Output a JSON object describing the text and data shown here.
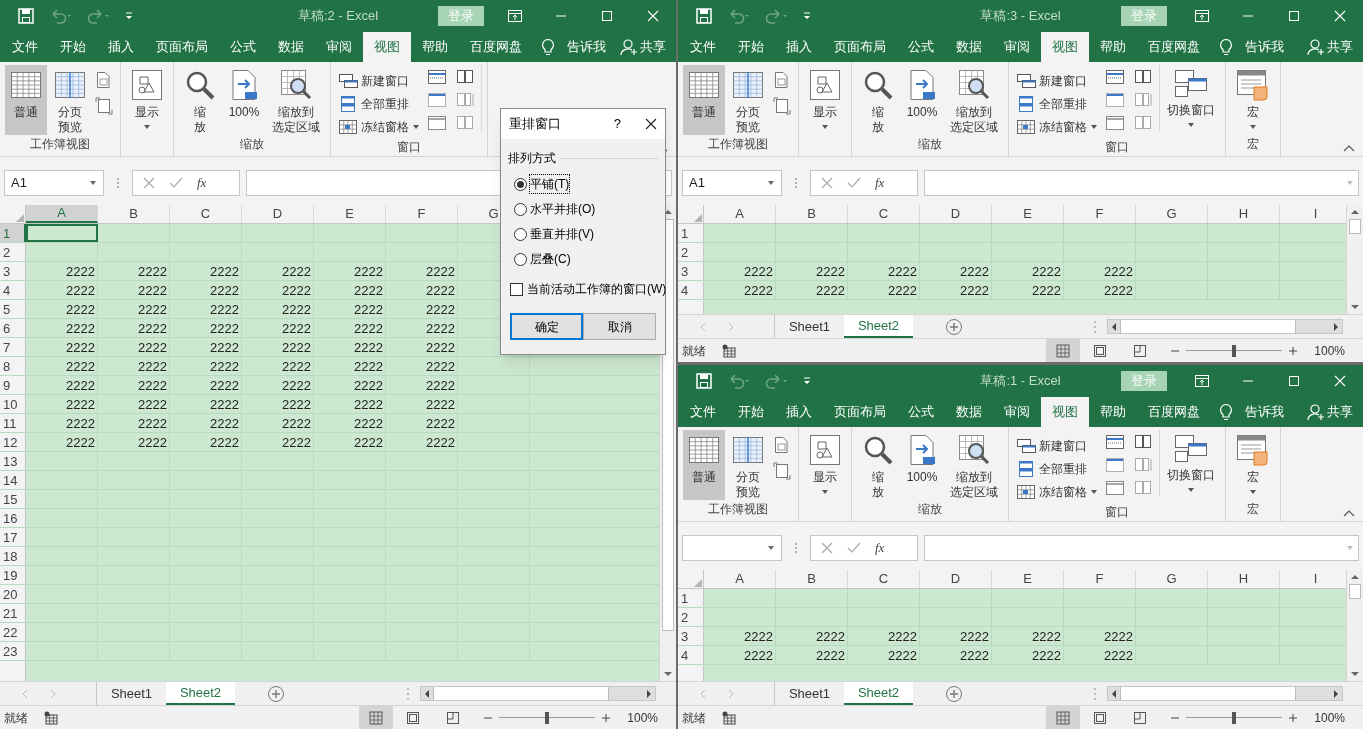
{
  "windows": [
    {
      "title": "草稿:2 - Excel",
      "login": "登录",
      "tabs": [
        {
          "label": "文件",
          "selected": false
        },
        {
          "label": "开始",
          "selected": false
        },
        {
          "label": "插入",
          "selected": false
        },
        {
          "label": "页面布局",
          "selected": false
        },
        {
          "label": "公式",
          "selected": false
        },
        {
          "label": "数据",
          "selected": false
        },
        {
          "label": "审阅",
          "selected": false
        },
        {
          "label": "视图",
          "selected": true
        },
        {
          "label": "帮助",
          "selected": false
        },
        {
          "label": "百度网盘",
          "selected": false
        }
      ],
      "tell": "告诉我",
      "share": "共享",
      "ribbon": [
        {
          "kind": "views",
          "label": "工作簿视图",
          "items": [
            {
              "label": "普通",
              "kind": "big",
              "selected": true
            },
            {
              "lines": [
                "分页",
                "预览"
              ],
              "kind": "big",
              "selected": false
            }
          ]
        },
        {
          "kind": "display",
          "items": [
            {
              "label": "显示",
              "kind": "big_dropdown"
            }
          ]
        },
        {
          "kind": "zoom",
          "label": "缩放",
          "items": [
            {
              "lines": [
                "缩",
                "放"
              ],
              "kind": "big"
            },
            {
              "label": "100%",
              "kind": "big"
            },
            {
              "lines": [
                "缩放到",
                "选定区域"
              ],
              "kind": "big"
            }
          ]
        },
        {
          "kind": "window",
          "label": "窗口",
          "items": [
            {
              "label": "新建窗口",
              "kind": "small"
            },
            {
              "label": "全部重排",
              "kind": "small"
            },
            {
              "label": "冻结窗格",
              "kind": "small_dropdown"
            }
          ]
        }
      ],
      "name_box": "A1",
      "insert_function": "fx",
      "columns": [
        {
          "label": "A",
          "selected": true
        },
        {
          "label": "B",
          "selected": false
        },
        {
          "label": "C",
          "selected": false
        },
        {
          "label": "D",
          "selected": false
        },
        {
          "label": "E",
          "selected": false
        },
        {
          "label": "F",
          "selected": false
        },
        {
          "label": "G",
          "selected": false
        }
      ],
      "rows": [
        {
          "header": "1",
          "selected": true
        },
        {
          "header": "2",
          "selected": false
        },
        {
          "header": "3",
          "selected": false,
          "cells": [
            "2222",
            "2222",
            "2222",
            "2222",
            "2222",
            "2222"
          ]
        },
        {
          "header": "4",
          "selected": false,
          "cells": [
            "2222",
            "2222",
            "2222",
            "2222",
            "2222",
            "2222"
          ]
        },
        {
          "header": "5",
          "selected": false,
          "cells": [
            "2222",
            "2222",
            "2222",
            "2222",
            "2222",
            "2222"
          ]
        },
        {
          "header": "6",
          "selected": false,
          "cells": [
            "2222",
            "2222",
            "2222",
            "2222",
            "2222",
            "2222"
          ]
        },
        {
          "header": "7",
          "selected": false,
          "cells": [
            "2222",
            "2222",
            "2222",
            "2222",
            "2222",
            "2222"
          ]
        },
        {
          "header": "8",
          "selected": false,
          "cells": [
            "2222",
            "2222",
            "2222",
            "2222",
            "2222",
            "2222"
          ]
        },
        {
          "header": "9",
          "selected": false,
          "cells": [
            "2222",
            "2222",
            "2222",
            "2222",
            "2222",
            "2222"
          ]
        },
        {
          "header": "10",
          "selected": false,
          "cells": [
            "2222",
            "2222",
            "2222",
            "2222",
            "2222",
            "2222"
          ]
        },
        {
          "header": "11",
          "selected": false,
          "cells": [
            "2222",
            "2222",
            "2222",
            "2222",
            "2222",
            "2222"
          ]
        },
        {
          "header": "12",
          "selected": false,
          "cells": [
            "2222",
            "2222",
            "2222",
            "2222",
            "2222",
            "2222"
          ]
        },
        {
          "header": "13",
          "selected": false
        },
        {
          "header": "14",
          "selected": false
        },
        {
          "header": "15",
          "selected": false
        },
        {
          "header": "16",
          "selected": false
        },
        {
          "header": "17",
          "selected": false
        },
        {
          "header": "18",
          "selected": false
        },
        {
          "header": "19",
          "selected": false
        },
        {
          "header": "20",
          "selected": false
        },
        {
          "header": "21",
          "selected": false
        },
        {
          "header": "22",
          "selected": false
        },
        {
          "header": "23",
          "selected": false
        }
      ],
      "sheets": [
        {
          "label": "Sheet1",
          "selected": false
        },
        {
          "label": "Sheet2",
          "selected": true
        }
      ],
      "status": "就绪",
      "zoom": "100%",
      "zoom_slider": {
        "level": 0.5
      }
    },
    {
      "title": "草稿:3 - Excel",
      "login": "登录",
      "tabs": [
        {
          "label": "文件",
          "selected": false
        },
        {
          "label": "开始",
          "selected": false
        },
        {
          "label": "插入",
          "selected": false
        },
        {
          "label": "页面布局",
          "selected": false
        },
        {
          "label": "公式",
          "selected": false
        },
        {
          "label": "数据",
          "selected": false
        },
        {
          "label": "审阅",
          "selected": false
        },
        {
          "label": "视图",
          "selected": true
        },
        {
          "label": "帮助",
          "selected": false
        },
        {
          "label": "百度网盘",
          "selected": false
        }
      ],
      "tell": "告诉我",
      "share": "共享",
      "ribbon": [
        {
          "kind": "views",
          "label": "工作簿视图",
          "items": [
            {
              "label": "普通",
              "kind": "big",
              "selected": true
            },
            {
              "lines": [
                "分页",
                "预览"
              ],
              "kind": "big",
              "selected": false
            }
          ]
        },
        {
          "kind": "display",
          "items": [
            {
              "label": "显示",
              "kind": "big_dropdown"
            }
          ]
        },
        {
          "kind": "zoom",
          "label": "缩放",
          "items": [
            {
              "lines": [
                "缩",
                "放"
              ],
              "kind": "big"
            },
            {
              "label": "100%",
              "kind": "big"
            },
            {
              "lines": [
                "缩放到",
                "选定区域"
              ],
              "kind": "big"
            }
          ]
        },
        {
          "kind": "window",
          "label": "窗口",
          "items": [
            {
              "label": "新建窗口",
              "kind": "small"
            },
            {
              "label": "全部重排",
              "kind": "small"
            },
            {
              "label": "冻结窗格",
              "kind": "small_dropdown"
            },
            {
              "label": "切换窗口",
              "kind": "big_dropdown"
            }
          ]
        },
        {
          "kind": "macro",
          "label": "宏",
          "items": [
            {
              "label": "宏",
              "kind": "big_dropdown"
            }
          ]
        }
      ],
      "name_box": "A1",
      "insert_function": "fx",
      "columns": [
        {
          "label": "A",
          "selected": false
        },
        {
          "label": "B",
          "selected": false
        },
        {
          "label": "C",
          "selected": false
        },
        {
          "label": "D",
          "selected": false
        },
        {
          "label": "E",
          "selected": false
        },
        {
          "label": "F",
          "selected": false
        },
        {
          "label": "G",
          "selected": false
        },
        {
          "label": "H",
          "selected": false
        },
        {
          "label": "I",
          "selected": false
        }
      ],
      "rows": [
        {
          "header": "1",
          "selected": false
        },
        {
          "header": "2",
          "selected": false
        },
        {
          "header": "3",
          "selected": false,
          "cells": [
            "2222",
            "2222",
            "2222",
            "2222",
            "2222",
            "2222"
          ]
        },
        {
          "header": "4",
          "selected": false,
          "cells": [
            "2222",
            "2222",
            "2222",
            "2222",
            "2222",
            "2222"
          ]
        }
      ],
      "sheets": [
        {
          "label": "Sheet1",
          "selected": false
        },
        {
          "label": "Sheet2",
          "selected": true
        }
      ],
      "status": "就绪",
      "zoom": "100%",
      "zoom_slider": {
        "level": 0.5
      }
    },
    {
      "title": "草稿:1 - Excel",
      "login": "登录",
      "tabs": [
        {
          "label": "文件",
          "selected": false
        },
        {
          "label": "开始",
          "selected": false
        },
        {
          "label": "插入",
          "selected": false
        },
        {
          "label": "页面布局",
          "selected": false
        },
        {
          "label": "公式",
          "selected": false
        },
        {
          "label": "数据",
          "selected": false
        },
        {
          "label": "审阅",
          "selected": false
        },
        {
          "label": "视图",
          "selected": true
        },
        {
          "label": "帮助",
          "selected": false
        },
        {
          "label": "百度网盘",
          "selected": false
        }
      ],
      "tell": "告诉我",
      "share": "共享",
      "ribbon": [
        {
          "kind": "views",
          "label": "工作簿视图",
          "items": [
            {
              "label": "普通",
              "kind": "big",
              "selected": true
            },
            {
              "lines": [
                "分页",
                "预览"
              ],
              "kind": "big",
              "selected": false
            }
          ]
        },
        {
          "kind": "display",
          "items": [
            {
              "label": "显示",
              "kind": "big_dropdown"
            }
          ]
        },
        {
          "kind": "zoom",
          "label": "缩放",
          "items": [
            {
              "lines": [
                "缩",
                "放"
              ],
              "kind": "big"
            },
            {
              "label": "100%",
              "kind": "big"
            },
            {
              "lines": [
                "缩放到",
                "选定区域"
              ],
              "kind": "big"
            }
          ]
        },
        {
          "kind": "window",
          "label": "窗口",
          "items": [
            {
              "label": "新建窗口",
              "kind": "small"
            },
            {
              "label": "全部重排",
              "kind": "small"
            },
            {
              "label": "冻结窗格",
              "kind": "small_dropdown"
            },
            {
              "label": "切换窗口",
              "kind": "big_dropdown"
            }
          ]
        },
        {
          "kind": "macro",
          "label": "宏",
          "items": [
            {
              "label": "宏",
              "kind": "big_dropdown"
            }
          ]
        }
      ],
      "insert_function": "fx",
      "columns": [
        {
          "label": "A",
          "selected": false
        },
        {
          "label": "B",
          "selected": false
        },
        {
          "label": "C",
          "selected": false
        },
        {
          "label": "D",
          "selected": false
        },
        {
          "label": "E",
          "selected": false
        },
        {
          "label": "F",
          "selected": false
        },
        {
          "label": "G",
          "selected": false
        },
        {
          "label": "H",
          "selected": false
        },
        {
          "label": "I",
          "selected": false
        }
      ],
      "rows": [
        {
          "header": "1",
          "selected": false
        },
        {
          "header": "2",
          "selected": false
        },
        {
          "header": "3",
          "selected": false,
          "cells": [
            "2222",
            "2222",
            "2222",
            "2222",
            "2222",
            "2222"
          ]
        },
        {
          "header": "4",
          "selected": false,
          "cells": [
            "2222",
            "2222",
            "2222",
            "2222",
            "2222",
            "2222"
          ]
        }
      ],
      "sheets": [
        {
          "label": "Sheet1",
          "selected": false
        },
        {
          "label": "Sheet2",
          "selected": true
        }
      ],
      "status": "就绪",
      "zoom": "100%",
      "zoom_slider": {
        "level": 0.5
      }
    }
  ],
  "dialog": {
    "title": "重排窗口",
    "help": "?",
    "section": "排列方式",
    "options": [
      {
        "label": "平铺(T)",
        "selected": true
      },
      {
        "label": "水平并排(O)",
        "selected": false
      },
      {
        "label": "垂直并排(V)",
        "selected": false
      },
      {
        "label": "层叠(C)",
        "selected": false
      }
    ],
    "checkbox": {
      "label": "当前活动工作簿的窗口(W)",
      "checked": false
    },
    "ok": "确定",
    "cancel": "取消"
  }
}
